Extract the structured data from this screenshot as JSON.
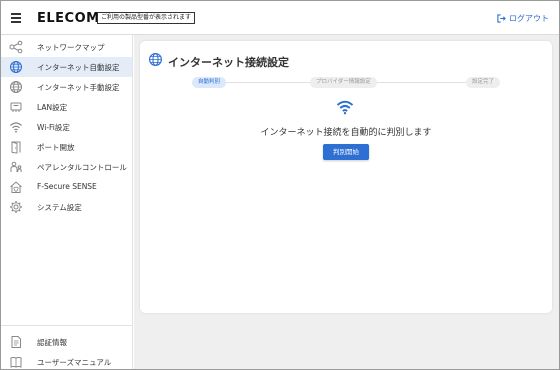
{
  "header": {
    "brand": "ELECOM",
    "notice": "ご利用の製品型番が表示されます",
    "logout_label": "ログアウト"
  },
  "sidebar": {
    "items": [
      {
        "label": "ネットワークマップ",
        "icon": "network-map-icon"
      },
      {
        "label": "インターネット自動設定",
        "icon": "globe-icon",
        "active": true
      },
      {
        "label": "インターネット手動設定",
        "icon": "globe-icon"
      },
      {
        "label": "LAN設定",
        "icon": "lan-icon"
      },
      {
        "label": "Wi-Fi設定",
        "icon": "wifi-icon"
      },
      {
        "label": "ポート開放",
        "icon": "door-icon"
      },
      {
        "label": "ペアレンタルコントロール",
        "icon": "parental-icon"
      },
      {
        "label": "F-Secure SENSE",
        "icon": "home-shield-icon"
      },
      {
        "label": "システム設定",
        "icon": "gear-icon"
      }
    ],
    "bottom_items": [
      {
        "label": "認証情報",
        "icon": "document-icon"
      },
      {
        "label": "ユーザーズマニュアル",
        "icon": "book-icon"
      }
    ]
  },
  "main": {
    "title": "インターネット接続設定",
    "steps": [
      "自動判別",
      "プロバイダー情報設定",
      "設定完了"
    ],
    "message": "インターネット接続を自動的に判別します",
    "start_button": "判別開始"
  },
  "colors": {
    "accent": "#2d6fd2",
    "active_bg": "#e4ecf8",
    "main_bg": "#efefef"
  }
}
